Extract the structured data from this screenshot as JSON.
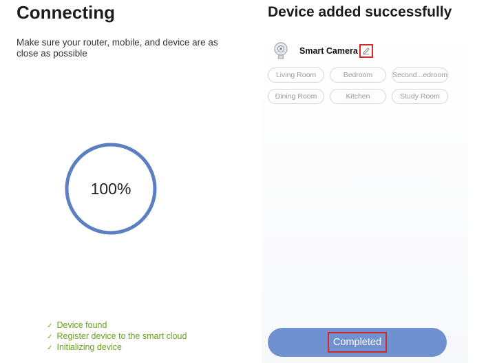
{
  "connecting": {
    "title": "Connecting",
    "instructions": "Make sure your router, mobile, and device are as close as possible",
    "progress_percent": 100,
    "progress_label": "100%",
    "steps": [
      {
        "icon": "check-icon",
        "label": "Device found"
      },
      {
        "icon": "check-icon",
        "label": "Register device to the smart cloud"
      },
      {
        "icon": "check-icon",
        "label": "Initializing device"
      }
    ]
  },
  "added": {
    "title": "Device added successfully",
    "device": {
      "icon": "camera-icon",
      "name": "Smart Camera",
      "edit_icon": "pencil-icon"
    },
    "rooms": [
      "Living Room",
      "Bedroom",
      "Second...edroom",
      "Dining Room",
      "Kitchen",
      "Study Room"
    ],
    "completed_label": "Completed"
  },
  "colors": {
    "accent": "#6f91cf",
    "ring": "#5b7fc0",
    "success": "#6aa321",
    "highlight": "#d62828"
  }
}
